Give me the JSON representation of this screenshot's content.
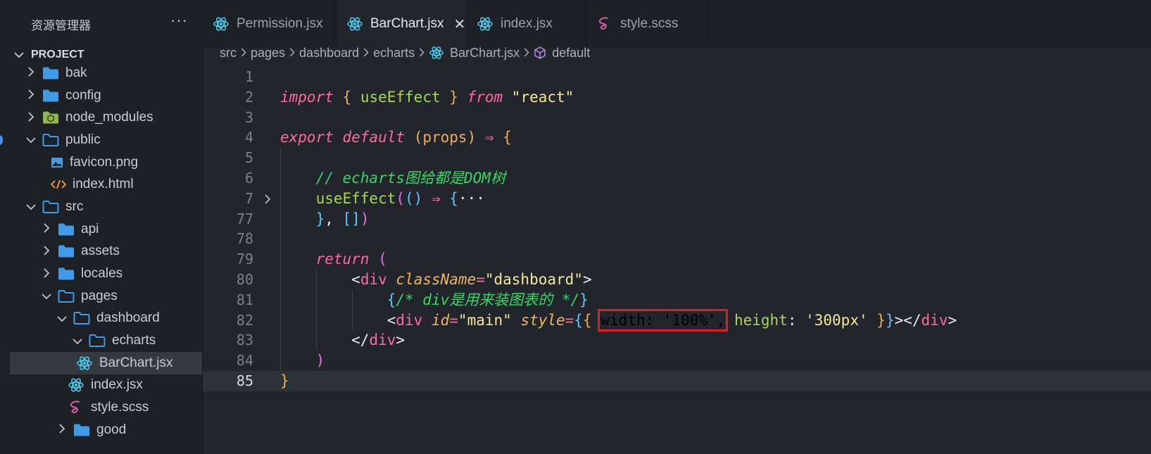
{
  "explorer": {
    "title": "资源管理器",
    "more": "···",
    "project": "PROJECT",
    "items": [
      {
        "label": "bak",
        "type": "folder",
        "depth": 0,
        "expanded": false
      },
      {
        "label": "config",
        "type": "folder",
        "depth": 0,
        "expanded": false
      },
      {
        "label": "node_modules",
        "type": "node-folder",
        "depth": 0,
        "expanded": false
      },
      {
        "label": "public",
        "type": "folder",
        "depth": 0,
        "expanded": true
      },
      {
        "label": "favicon.png",
        "type": "image",
        "depth": 1
      },
      {
        "label": "index.html",
        "type": "html",
        "depth": 1
      },
      {
        "label": "src",
        "type": "folder",
        "depth": 0,
        "expanded": true
      },
      {
        "label": "api",
        "type": "folder",
        "depth": 1,
        "expanded": false
      },
      {
        "label": "assets",
        "type": "folder",
        "depth": 1,
        "expanded": false
      },
      {
        "label": "locales",
        "type": "folder",
        "depth": 1,
        "expanded": false
      },
      {
        "label": "pages",
        "type": "folder",
        "depth": 1,
        "expanded": true
      },
      {
        "label": "dashboard",
        "type": "folder",
        "depth": 2,
        "expanded": true
      },
      {
        "label": "echarts",
        "type": "folder",
        "depth": 3,
        "expanded": true
      },
      {
        "label": "BarChart.jsx",
        "type": "react",
        "depth": 4,
        "selected": true
      },
      {
        "label": "index.jsx",
        "type": "react",
        "depth": 3
      },
      {
        "label": "style.scss",
        "type": "sass",
        "depth": 3
      },
      {
        "label": "good",
        "type": "folder",
        "depth": 2,
        "expanded": false
      }
    ]
  },
  "tabs": [
    {
      "label": "Permission.jsx",
      "icon": "react-icon",
      "active": false
    },
    {
      "label": "BarChart.jsx",
      "icon": "react-icon",
      "active": true,
      "close": "✕"
    },
    {
      "label": "index.jsx",
      "icon": "react-icon",
      "active": false
    },
    {
      "label": "style.scss",
      "icon": "sass-icon",
      "active": false
    }
  ],
  "breadcrumb": [
    "src",
    "pages",
    "dashboard",
    "echarts",
    "BarChart.jsx",
    "default"
  ],
  "editor": {
    "lines": [
      {
        "n": "1",
        "tokens": []
      },
      {
        "n": "2",
        "tokens": [
          [
            "kw",
            "import"
          ],
          [
            "pn",
            " "
          ],
          [
            "br",
            "{"
          ],
          [
            "fn",
            " useEffect "
          ],
          [
            "br",
            "}"
          ],
          [
            "pn",
            " "
          ],
          [
            "kw",
            "from"
          ],
          [
            "pn",
            " "
          ],
          [
            "str",
            "\"react\""
          ]
        ]
      },
      {
        "n": "3",
        "tokens": []
      },
      {
        "n": "4",
        "tokens": [
          [
            "kw",
            "export"
          ],
          [
            "pn",
            " "
          ],
          [
            "kw",
            "default"
          ],
          [
            "pn",
            " "
          ],
          [
            "br",
            "("
          ],
          [
            "br",
            "props"
          ],
          [
            "br",
            ")"
          ],
          [
            "pn",
            " "
          ],
          [
            "op",
            "⇒"
          ],
          [
            "pn",
            " "
          ],
          [
            "br",
            "{"
          ]
        ]
      },
      {
        "n": "5",
        "tokens": []
      },
      {
        "n": "6",
        "tokens": [
          [
            "pn",
            "    "
          ],
          [
            "cmt",
            "// echarts图给都是DOM树"
          ]
        ]
      },
      {
        "n": "7",
        "fold": "›",
        "tokens": [
          [
            "pn",
            "    "
          ],
          [
            "fn",
            "useEffect"
          ],
          [
            "b3",
            "("
          ],
          [
            "b2",
            "()"
          ],
          [
            "pn",
            " "
          ],
          [
            "op",
            "⇒"
          ],
          [
            "pn",
            " "
          ],
          [
            "b2",
            "{"
          ],
          [
            "pn",
            "···"
          ]
        ]
      },
      {
        "n": "77",
        "tokens": [
          [
            "pn",
            "    "
          ],
          [
            "b2",
            "}"
          ],
          [
            "pn",
            ", "
          ],
          [
            "b2",
            "[]"
          ],
          [
            "b3",
            ")"
          ]
        ]
      },
      {
        "n": "78",
        "tokens": []
      },
      {
        "n": "79",
        "tokens": [
          [
            "pn",
            "    "
          ],
          [
            "kw",
            "return"
          ],
          [
            "pn",
            " "
          ],
          [
            "b3",
            "("
          ]
        ]
      },
      {
        "n": "80",
        "tokens": [
          [
            "pn",
            "        "
          ],
          [
            "tagb",
            "<"
          ],
          [
            "tag",
            "div"
          ],
          [
            "pn",
            " "
          ],
          [
            "attr",
            "className"
          ],
          [
            "op",
            "="
          ],
          [
            "str",
            "\"dashboard\""
          ],
          [
            "tagb",
            ">"
          ]
        ]
      },
      {
        "n": "81",
        "tokens": [
          [
            "pn",
            "            "
          ],
          [
            "b2",
            "{"
          ],
          [
            "cmt",
            "/* div是用来装图表的 */"
          ],
          [
            "b2",
            "}"
          ]
        ]
      },
      {
        "n": "82",
        "tokens": [
          [
            "pn",
            "            "
          ],
          [
            "tagb",
            "<"
          ],
          [
            "tag",
            "div"
          ],
          [
            "pn",
            " "
          ],
          [
            "attr",
            "id"
          ],
          [
            "op",
            "="
          ],
          [
            "str",
            "\"main\""
          ],
          [
            "pn",
            " "
          ],
          [
            "attr",
            "style"
          ],
          [
            "op",
            "="
          ],
          [
            "b2",
            "{"
          ],
          [
            "br",
            "{"
          ],
          [
            "pn",
            " "
          ],
          [
            "hl",
            "width: '100%',"
          ],
          [
            "pn",
            " "
          ],
          [
            "fn",
            "height"
          ],
          [
            "pn",
            ": "
          ],
          [
            "str",
            "'300px'"
          ],
          [
            "pn",
            " "
          ],
          [
            "br",
            "}"
          ],
          [
            "b2",
            "}"
          ],
          [
            "tagb",
            "></"
          ],
          [
            "tag",
            "div"
          ],
          [
            "tagb",
            ">"
          ]
        ]
      },
      {
        "n": "83",
        "tokens": [
          [
            "pn",
            "        "
          ],
          [
            "tagb",
            "</"
          ],
          [
            "tag",
            "div"
          ],
          [
            "tagb",
            ">"
          ]
        ]
      },
      {
        "n": "84",
        "tokens": [
          [
            "pn",
            "    "
          ],
          [
            "b3",
            ")"
          ]
        ]
      },
      {
        "n": "85",
        "current": true,
        "tokens": [
          [
            "br",
            "}"
          ]
        ]
      }
    ]
  }
}
